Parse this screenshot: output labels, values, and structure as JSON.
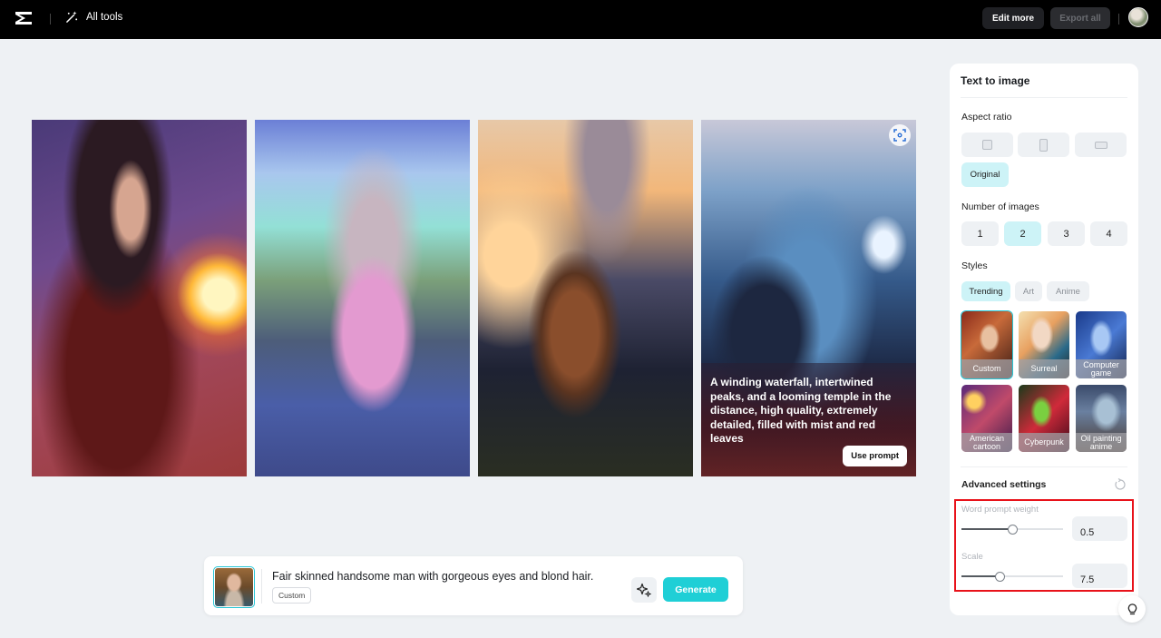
{
  "topbar": {
    "all_tools_label": "All tools",
    "edit_more_label": "Edit more",
    "export_all_label": "Export all"
  },
  "gallery": {
    "images": [
      {
        "subject": "fantasy warrior woman with fireball"
      },
      {
        "subject": "pink car in front of castle"
      },
      {
        "subject": "cat sitting before mountains at sunset"
      },
      {
        "subject": "waterfall and temple among peaks",
        "prompt": "A winding waterfall, intertwined peaks, and a looming temple in the distance, high quality, extremely detailed, filled with mist and red leaves",
        "use_prompt_label": "Use prompt"
      }
    ]
  },
  "prompt_bar": {
    "prompt_value": "Fair skinned handsome man with gorgeous eyes and blond hair.",
    "style_tag": "Custom",
    "generate_label": "Generate"
  },
  "panel": {
    "title": "Text to image",
    "aspect_ratio": {
      "label": "Aspect ratio",
      "options": [
        "square",
        "portrait",
        "landscape"
      ],
      "original_label": "Original",
      "selected": "Original"
    },
    "number_of_images": {
      "label": "Number of images",
      "options": [
        "1",
        "2",
        "3",
        "4"
      ],
      "selected": "2"
    },
    "styles": {
      "label": "Styles",
      "tabs": [
        "Trending",
        "Art",
        "Anime"
      ],
      "active_tab": "Trending",
      "items": [
        "Custom",
        "Surreal",
        "Computer game",
        "American cartoon",
        "Cyberpunk",
        "Oil painting anime"
      ],
      "selected": "Custom"
    },
    "advanced": {
      "label": "Advanced settings",
      "word_prompt_weight": {
        "label": "Word prompt weight",
        "value": "0.5",
        "fraction": 0.5
      },
      "scale": {
        "label": "Scale",
        "value": "7.5",
        "fraction": 0.375
      }
    }
  },
  "colors": {
    "accent": "#1fcfd6",
    "accent_light": "#cdf3f7",
    "highlight_box": "#e8121a",
    "topbar_bg": "#000000",
    "page_bg": "#eef1f4"
  }
}
